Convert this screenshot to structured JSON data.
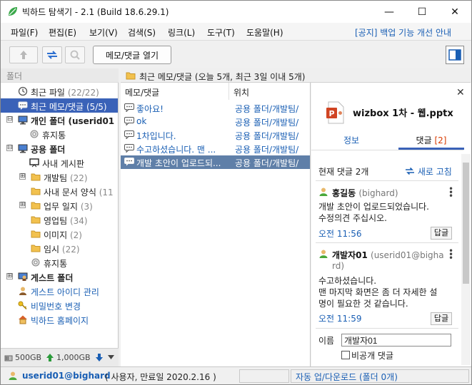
{
  "window": {
    "title": "빅하드 탐색기 - 2.1 (Build 18.6.29.1)",
    "controls": {
      "minimize": "—",
      "maximize": "☐",
      "close": "✕"
    }
  },
  "menu": {
    "items": [
      "파일(F)",
      "편집(E)",
      "보기(V)",
      "검색(S)",
      "링크(L)",
      "도구(T)",
      "도움말(H)"
    ],
    "notice": "[공지] 백업 기능 개선 안내"
  },
  "toolbar": {
    "memo_button": "메모/댓글 열기",
    "icons": [
      "up-arrow-icon",
      "sync-icon",
      "search-icon"
    ]
  },
  "left": {
    "header": "폴더",
    "tree": [
      {
        "label": "최근 파일",
        "count": "(22/22)",
        "icon": "clock-icon"
      },
      {
        "label": "최근 메모/댓글",
        "count": "(5/5)",
        "icon": "comment-icon",
        "selected": true
      },
      {
        "label": "개인 폴더 (userid01",
        "count": "",
        "icon": "computer-icon",
        "expander": "⊟",
        "bold": true
      },
      {
        "label": "휴지통",
        "count": "",
        "icon": "trash-icon"
      },
      {
        "label": "공용 폴더",
        "count": "",
        "icon": "computer-icon",
        "expander": "⊟",
        "bold": true
      },
      {
        "label": "사내 게시판",
        "count": "",
        "icon": "board-icon"
      },
      {
        "label": "개발팀",
        "count": "(22)",
        "icon": "folder-icon",
        "expander": "⊞"
      },
      {
        "label": "사내 문서 양식",
        "count": "(11",
        "icon": "folder-icon"
      },
      {
        "label": "업무 일지",
        "count": "(3)",
        "icon": "folder-icon",
        "expander": "⊞"
      },
      {
        "label": "영업팀",
        "count": "(34)",
        "icon": "folder-icon"
      },
      {
        "label": "이미지",
        "count": "(2)",
        "icon": "folder-icon"
      },
      {
        "label": "임시",
        "count": "(22)",
        "icon": "folder-icon"
      },
      {
        "label": "휴지통",
        "count": "",
        "icon": "trash-icon"
      },
      {
        "label": "게스트 폴더",
        "count": "",
        "icon": "guest-icon",
        "expander": "⊞",
        "bold": true
      },
      {
        "label": "게스트 아이디 관리",
        "count": "",
        "icon": "user-icon",
        "link": true
      },
      {
        "label": "비밀번호 변경",
        "count": "",
        "icon": "key-icon",
        "link": true
      },
      {
        "label": "빅하드 홈페이지",
        "count": "",
        "icon": "home-icon",
        "link": true
      }
    ],
    "storage": {
      "total": "500GB",
      "up": "1,000GB"
    }
  },
  "middle": {
    "header": "최근 메모/댓글 (오늘 5개, 최근 3일 이내 5개)",
    "columns": [
      "메모/댓글",
      "위치"
    ],
    "rows": [
      {
        "text": "좋아요!",
        "location": "공용 폴더/개발팀/",
        "selected": false
      },
      {
        "text": "ok",
        "location": "공용 폴더/개발팀/",
        "selected": false
      },
      {
        "text": "1차입니다.",
        "location": "공용 폴더/개발팀/",
        "selected": false
      },
      {
        "text": "수고하셨습니다. 맨 ...",
        "location": "공용 폴더/개발팀/",
        "selected": false
      },
      {
        "text": "개발 초안이 업로드되...",
        "location": "공용 폴더/개발팀/",
        "selected": true
      }
    ]
  },
  "right": {
    "file_name": "wizbox 1차 - 웹.pptx",
    "tabs": {
      "info": "정보",
      "comments": "댓글",
      "comments_count": "[2]"
    },
    "count_text": "현재 댓글 2개",
    "refresh": "새로 고침",
    "comments": [
      {
        "author": "홍길동",
        "uid": "(bighard)",
        "lines": [
          "개발 초안이 업로드되었습니다.",
          "수정의견 주십시오."
        ],
        "time": "오전 11:56",
        "reply": "답글"
      },
      {
        "author": "개발자01",
        "uid": "(userid01@bigha",
        "uid_cont": "rd)",
        "lines": [
          "수고하셨습니다.",
          "맨 마지막 화면은 좀 더 자세한 설",
          "명이 필요한 것 같습니다."
        ],
        "time": "오전 11:59",
        "reply": "답글"
      }
    ],
    "name_label": "이름",
    "name_value": "개발자01",
    "secret_label": "비공개 댓글"
  },
  "status": {
    "user": "userid01@bighard",
    "role": "( 사용자, 만료일 2020.2.16 )",
    "sync": "자동 업/다운로드 (폴더 0개)"
  },
  "colors": {
    "selection": "#3a62b8",
    "link": "#1a5fb4",
    "accent_red": "#d83b01"
  }
}
